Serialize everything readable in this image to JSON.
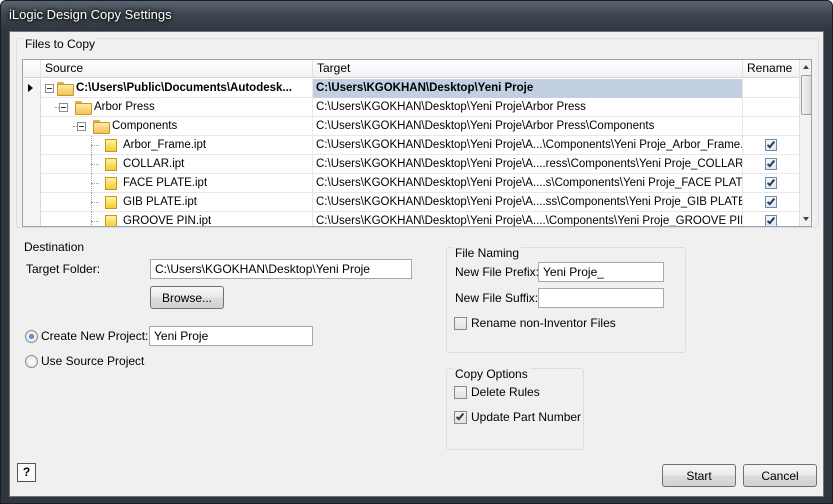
{
  "window": {
    "title": "iLogic Design Copy Settings"
  },
  "files_group": {
    "label": "Files to Copy",
    "columns": {
      "source": "Source",
      "target": "Target",
      "rename": "Rename"
    },
    "rows": [
      {
        "source": "C:\\Users\\Public\\Documents\\Autodesk...",
        "target": "C:\\Users\\KGOKHAN\\Desktop\\Yeni Proje",
        "rename": null
      },
      {
        "source": "Arbor Press",
        "target": "C:\\Users\\KGOKHAN\\Desktop\\Yeni Proje\\Arbor Press",
        "rename": null
      },
      {
        "source": "Components",
        "target": "C:\\Users\\KGOKHAN\\Desktop\\Yeni Proje\\Arbor Press\\Components",
        "rename": null
      },
      {
        "source": "Arbor_Frame.ipt",
        "target": "C:\\Users\\KGOKHAN\\Desktop\\Yeni Proje\\A...\\Components\\Yeni Proje_Arbor_Frame.ipt",
        "rename": true
      },
      {
        "source": "COLLAR.ipt",
        "target": "C:\\Users\\KGOKHAN\\Desktop\\Yeni Proje\\A....ress\\Components\\Yeni Proje_COLLAR.ipt",
        "rename": true
      },
      {
        "source": "FACE PLATE.ipt",
        "target": "C:\\Users\\KGOKHAN\\Desktop\\Yeni Proje\\A....s\\Components\\Yeni Proje_FACE PLATE.ipt",
        "rename": true
      },
      {
        "source": "GIB PLATE.ipt",
        "target": "C:\\Users\\KGOKHAN\\Desktop\\Yeni Proje\\A....ss\\Components\\Yeni Proje_GIB PLATE.ipt",
        "rename": true
      },
      {
        "source": "GROOVE PIN.ipt",
        "target": "C:\\Users\\KGOKHAN\\Desktop\\Yeni Proje\\A....\\Components\\Yeni Proje_GROOVE PIN.ipt",
        "rename": true
      }
    ]
  },
  "destination": {
    "label": "Destination",
    "target_folder_label": "Target Folder:",
    "target_folder_value": "C:\\Users\\KGOKHAN\\Desktop\\Yeni Proje",
    "browse_label": "Browse...",
    "create_new_project_label": "Create New Project:",
    "create_new_project_value": "Yeni Proje",
    "use_source_project_label": "Use Source Project",
    "selected_option": "create_new_project"
  },
  "file_naming": {
    "label": "File Naming",
    "prefix_label": "New File Prefix:",
    "prefix_value": "Yeni Proje_",
    "suffix_label": "New File Suffix:",
    "suffix_value": "",
    "rename_non_inventor_label": "Rename non-Inventor Files",
    "rename_non_inventor_checked": false
  },
  "copy_options": {
    "label": "Copy Options",
    "delete_rules_label": "Delete Rules",
    "delete_rules_checked": false,
    "update_part_number_label": "Update Part Number",
    "update_part_number_checked": true
  },
  "footer": {
    "help_label": "?",
    "start_label": "Start",
    "cancel_label": "Cancel"
  }
}
